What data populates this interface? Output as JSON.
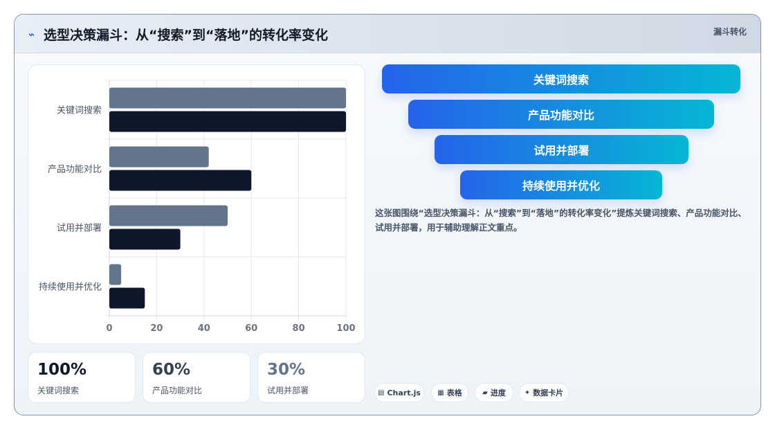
{
  "header": {
    "title": "选型决策漏斗：从“搜索”到“落地”的转化率变化",
    "tag": "漏斗转化"
  },
  "chart_data": {
    "type": "bar",
    "orientation": "horizontal",
    "categories": [
      "关键词搜索",
      "产品功能对比",
      "试用并部署",
      "持续使用并优化"
    ],
    "series": [
      {
        "values": [
          100,
          42,
          50,
          5
        ],
        "color": "#64748b"
      },
      {
        "values": [
          100,
          60,
          30,
          15
        ],
        "color": "#0f172a"
      }
    ],
    "xlim": [
      0,
      100
    ],
    "xticks": [
      "0",
      "20",
      "40",
      "60",
      "80",
      "100"
    ],
    "grid": true
  },
  "stats": [
    {
      "value": "100%",
      "label": "关键词搜索",
      "color": "#0f172a"
    },
    {
      "value": "60%",
      "label": "产品功能对比",
      "color": "#334155"
    },
    {
      "value": "30%",
      "label": "试用并部署",
      "color": "#64748b"
    }
  ],
  "funnel": [
    {
      "label": "关键词搜索"
    },
    {
      "label": "产品功能对比"
    },
    {
      "label": "试用并部署"
    },
    {
      "label": "持续使用并优化"
    }
  ],
  "description": "这张图围绕“选型决策漏斗：从“搜索”到“落地”的转化率变化”提炼关键词搜索、产品功能对比、试用并部署，用于辅助理解正文重点。",
  "chips": [
    {
      "icon": "chart-icon",
      "glyph": "▤",
      "label": "Chart.js"
    },
    {
      "icon": "table-icon",
      "glyph": "▦",
      "label": "表格"
    },
    {
      "icon": "progress-icon",
      "glyph": "▰",
      "label": "进度"
    },
    {
      "icon": "sparkle-icon",
      "glyph": "✦",
      "label": "数据卡片"
    }
  ]
}
